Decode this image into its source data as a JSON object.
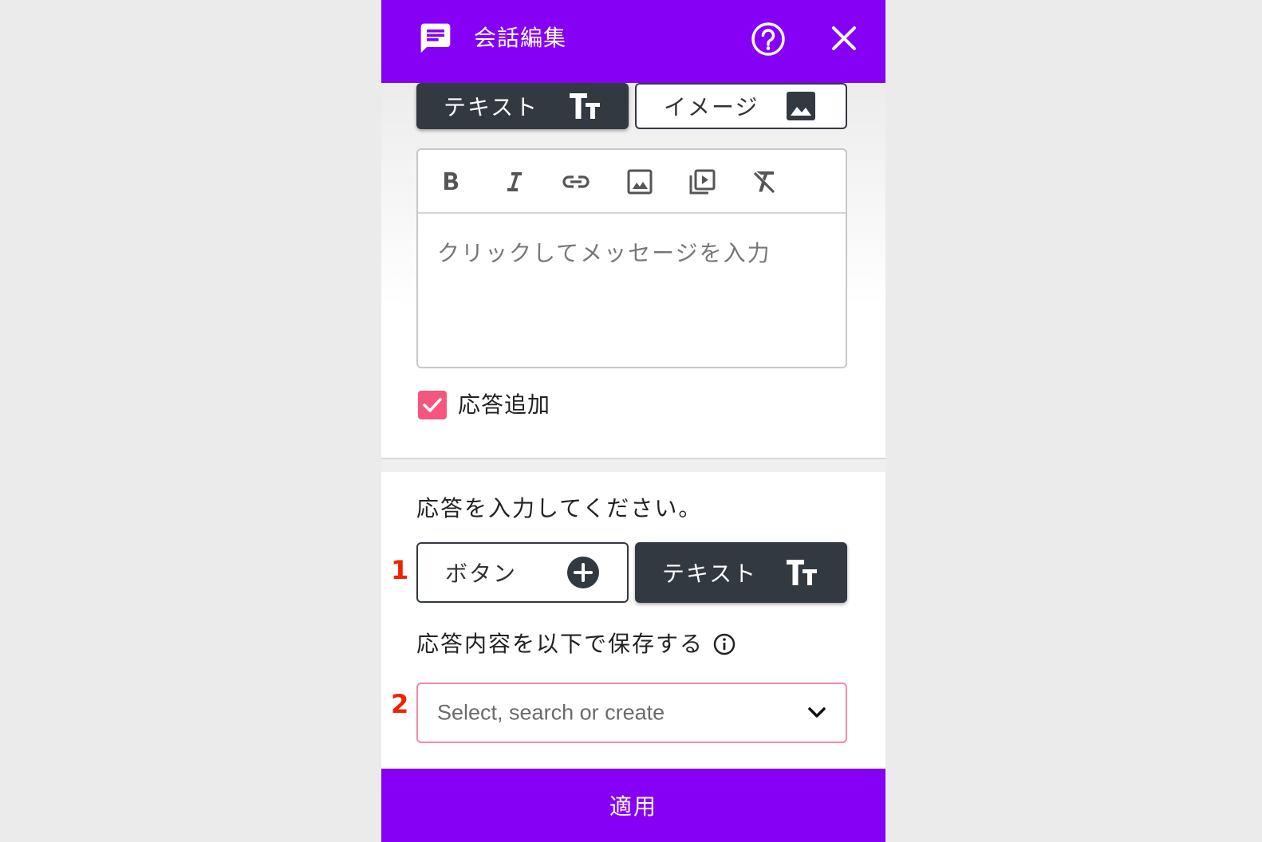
{
  "header": {
    "title": "会話編集",
    "icons": [
      "chat-icon",
      "help-icon",
      "close-icon"
    ]
  },
  "message_type": {
    "text_label": "テキスト",
    "image_label": "イメージ",
    "selected": "text"
  },
  "editor": {
    "toolbar": [
      "bold",
      "italic",
      "link",
      "image",
      "video",
      "clear-format"
    ],
    "placeholder": "クリックしてメッセージを入力"
  },
  "add_response": {
    "label": "応答追加",
    "checked": true
  },
  "response": {
    "prompt": "応答を入力してください。",
    "marker_1": "1",
    "button_label": "ボタン",
    "text_label": "テキスト",
    "selected": "text",
    "save_label": "応答内容を以下で保存する",
    "marker_2": "2",
    "select_placeholder": "Select, search or create"
  },
  "footer": {
    "apply_label": "適用"
  },
  "colors": {
    "brand": "#8500f5",
    "dark_button": "#333941",
    "checkbox": "#f5567e",
    "select_border": "#f28aa4",
    "marker": "#ee2200"
  }
}
